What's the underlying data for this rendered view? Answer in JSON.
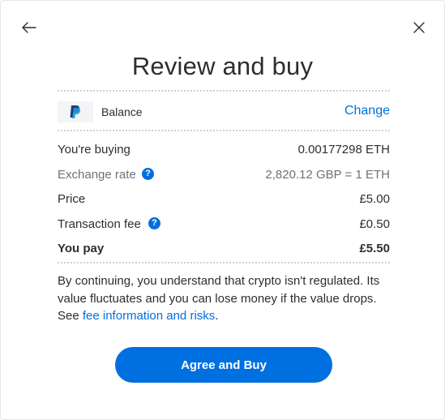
{
  "header": {
    "back_icon": "arrow-left-icon",
    "close_icon": "close-icon",
    "title": "Review and buy"
  },
  "funding_source": {
    "logo": "paypal-logo",
    "label": "Balance",
    "change_label": "Change"
  },
  "summary": {
    "buying_label": "You're buying",
    "buying_value": "0.00177298 ETH",
    "exchange_label": "Exchange rate",
    "exchange_value": "2,820.12 GBP = 1 ETH",
    "price_label": "Price",
    "price_value": "£5.00",
    "fee_label": "Transaction fee",
    "fee_value": "£0.50",
    "total_label": "You pay",
    "total_value": "£5.50",
    "help_glyph": "?"
  },
  "disclaimer": {
    "text": "By continuing, you understand that crypto isn't regulated. Its value fluctuates and you can lose money if the value drops. See ",
    "link": "fee information and risks",
    "suffix": "."
  },
  "cta": {
    "label": "Agree and Buy"
  },
  "colors": {
    "accent": "#0070e0",
    "text": "#2c2e2f",
    "muted": "#6c7378"
  }
}
